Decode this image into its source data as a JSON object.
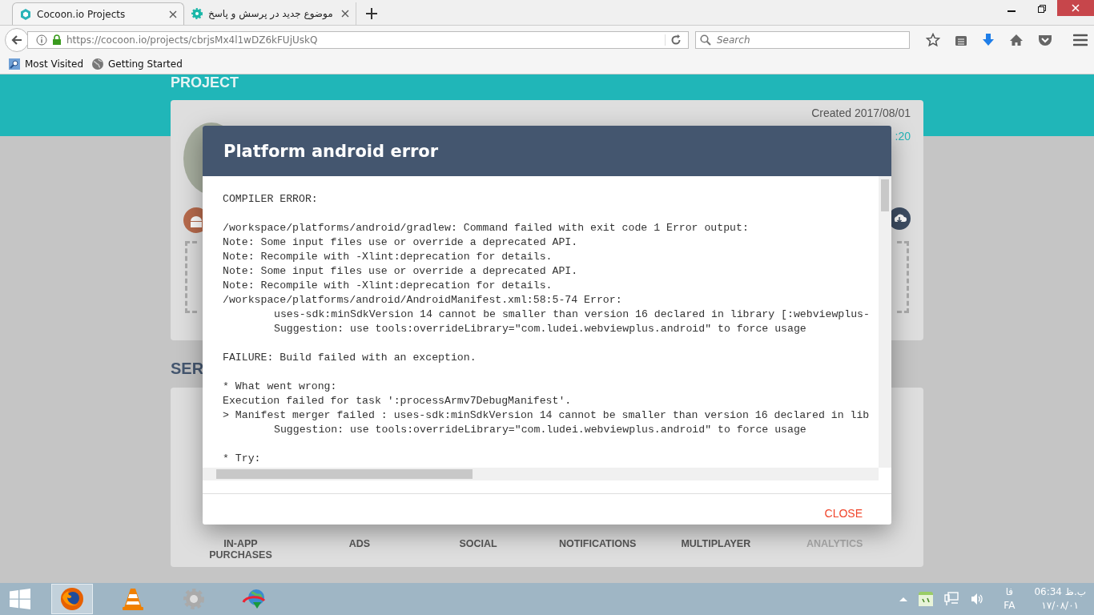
{
  "browser": {
    "tabs": [
      {
        "title": "Cocoon.io Projects",
        "selected": true
      },
      {
        "title": "موضوع جدید در پرسش و پاسخ",
        "selected": false
      }
    ],
    "address": "https://cocoon.io/projects/cbrjsMx4l1wDZ6kFUjUskQ",
    "search": {
      "placeholder": "Search"
    },
    "bookmarks": [
      "Most Visited",
      "Getting Started"
    ]
  },
  "page": {
    "header": "PROJECT",
    "created": "Created 2017/08/01",
    "updated": ":20",
    "section": "SER",
    "features": [
      {
        "label": "IN-APP PURCHASES",
        "disabled": false
      },
      {
        "label": "ADS",
        "disabled": false
      },
      {
        "label": "SOCIAL",
        "disabled": false
      },
      {
        "label": "NOTIFICATIONS",
        "disabled": false
      },
      {
        "label": "MULTIPLAYER",
        "disabled": false
      },
      {
        "label": "ANALYTICS",
        "disabled": true
      }
    ]
  },
  "dialog": {
    "title": "Platform android error",
    "output": [
      [
        {
          "text": "COMPILER ERROR:",
          "indent": false
        }
      ],
      [
        {
          "text": "/workspace/platforms/android/gradlew: Command failed with exit code 1 Error output:",
          "indent": false
        },
        {
          "text": "Note: Some input files use or override a deprecated API.",
          "indent": false
        },
        {
          "text": "Note: Recompile with -Xlint:deprecation for details.",
          "indent": false
        },
        {
          "text": "Note: Some input files use or override a deprecated API.",
          "indent": false
        },
        {
          "text": "Note: Recompile with -Xlint:deprecation for details.",
          "indent": false
        },
        {
          "text": "/workspace/platforms/android/AndroidManifest.xml:58:5-74 Error:",
          "indent": false
        },
        {
          "text": "uses-sdk:minSdkVersion 14 cannot be smaller than version 16 declared in library [:webviewplus-",
          "indent": true
        },
        {
          "text": "Suggestion: use tools:overrideLibrary=\"com.ludei.webviewplus.android\" to force usage",
          "indent": true
        }
      ],
      [
        {
          "text": "FAILURE: Build failed with an exception.",
          "indent": false
        }
      ],
      [
        {
          "text": "* What went wrong:",
          "indent": false
        },
        {
          "text": "Execution failed for task ':processArmv7DebugManifest'.",
          "indent": false
        },
        {
          "text": "> Manifest merger failed : uses-sdk:minSdkVersion 14 cannot be smaller than version 16 declared in lib",
          "indent": false
        },
        {
          "text": "Suggestion: use tools:overrideLibrary=\"com.ludei.webviewplus.android\" to force usage",
          "indent": true
        }
      ],
      [
        {
          "text": "* Try:",
          "indent": false
        }
      ]
    ],
    "close": "CLOSE"
  },
  "taskbar": {
    "apps": [
      {
        "kind": "firefox",
        "selected": true
      },
      {
        "kind": "vlc",
        "selected": false
      },
      {
        "kind": "gear",
        "selected": false
      },
      {
        "kind": "globe",
        "selected": false
      }
    ],
    "lang_short": "فا",
    "lang": "FA",
    "time": "06:34 ب.ظ",
    "date": "۱۷/۰۸/۰۱"
  }
}
